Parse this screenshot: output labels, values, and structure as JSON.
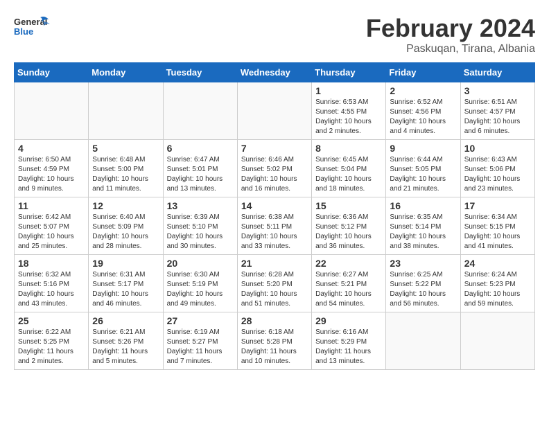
{
  "header": {
    "logo_general": "General",
    "logo_blue": "Blue",
    "month": "February 2024",
    "location": "Paskuqan, Tirana, Albania"
  },
  "weekdays": [
    "Sunday",
    "Monday",
    "Tuesday",
    "Wednesday",
    "Thursday",
    "Friday",
    "Saturday"
  ],
  "weeks": [
    [
      {
        "day": "",
        "info": ""
      },
      {
        "day": "",
        "info": ""
      },
      {
        "day": "",
        "info": ""
      },
      {
        "day": "",
        "info": ""
      },
      {
        "day": "1",
        "info": "Sunrise: 6:53 AM\nSunset: 4:55 PM\nDaylight: 10 hours\nand 2 minutes."
      },
      {
        "day": "2",
        "info": "Sunrise: 6:52 AM\nSunset: 4:56 PM\nDaylight: 10 hours\nand 4 minutes."
      },
      {
        "day": "3",
        "info": "Sunrise: 6:51 AM\nSunset: 4:57 PM\nDaylight: 10 hours\nand 6 minutes."
      }
    ],
    [
      {
        "day": "4",
        "info": "Sunrise: 6:50 AM\nSunset: 4:59 PM\nDaylight: 10 hours\nand 9 minutes."
      },
      {
        "day": "5",
        "info": "Sunrise: 6:48 AM\nSunset: 5:00 PM\nDaylight: 10 hours\nand 11 minutes."
      },
      {
        "day": "6",
        "info": "Sunrise: 6:47 AM\nSunset: 5:01 PM\nDaylight: 10 hours\nand 13 minutes."
      },
      {
        "day": "7",
        "info": "Sunrise: 6:46 AM\nSunset: 5:02 PM\nDaylight: 10 hours\nand 16 minutes."
      },
      {
        "day": "8",
        "info": "Sunrise: 6:45 AM\nSunset: 5:04 PM\nDaylight: 10 hours\nand 18 minutes."
      },
      {
        "day": "9",
        "info": "Sunrise: 6:44 AM\nSunset: 5:05 PM\nDaylight: 10 hours\nand 21 minutes."
      },
      {
        "day": "10",
        "info": "Sunrise: 6:43 AM\nSunset: 5:06 PM\nDaylight: 10 hours\nand 23 minutes."
      }
    ],
    [
      {
        "day": "11",
        "info": "Sunrise: 6:42 AM\nSunset: 5:07 PM\nDaylight: 10 hours\nand 25 minutes."
      },
      {
        "day": "12",
        "info": "Sunrise: 6:40 AM\nSunset: 5:09 PM\nDaylight: 10 hours\nand 28 minutes."
      },
      {
        "day": "13",
        "info": "Sunrise: 6:39 AM\nSunset: 5:10 PM\nDaylight: 10 hours\nand 30 minutes."
      },
      {
        "day": "14",
        "info": "Sunrise: 6:38 AM\nSunset: 5:11 PM\nDaylight: 10 hours\nand 33 minutes."
      },
      {
        "day": "15",
        "info": "Sunrise: 6:36 AM\nSunset: 5:12 PM\nDaylight: 10 hours\nand 36 minutes."
      },
      {
        "day": "16",
        "info": "Sunrise: 6:35 AM\nSunset: 5:14 PM\nDaylight: 10 hours\nand 38 minutes."
      },
      {
        "day": "17",
        "info": "Sunrise: 6:34 AM\nSunset: 5:15 PM\nDaylight: 10 hours\nand 41 minutes."
      }
    ],
    [
      {
        "day": "18",
        "info": "Sunrise: 6:32 AM\nSunset: 5:16 PM\nDaylight: 10 hours\nand 43 minutes."
      },
      {
        "day": "19",
        "info": "Sunrise: 6:31 AM\nSunset: 5:17 PM\nDaylight: 10 hours\nand 46 minutes."
      },
      {
        "day": "20",
        "info": "Sunrise: 6:30 AM\nSunset: 5:19 PM\nDaylight: 10 hours\nand 49 minutes."
      },
      {
        "day": "21",
        "info": "Sunrise: 6:28 AM\nSunset: 5:20 PM\nDaylight: 10 hours\nand 51 minutes."
      },
      {
        "day": "22",
        "info": "Sunrise: 6:27 AM\nSunset: 5:21 PM\nDaylight: 10 hours\nand 54 minutes."
      },
      {
        "day": "23",
        "info": "Sunrise: 6:25 AM\nSunset: 5:22 PM\nDaylight: 10 hours\nand 56 minutes."
      },
      {
        "day": "24",
        "info": "Sunrise: 6:24 AM\nSunset: 5:23 PM\nDaylight: 10 hours\nand 59 minutes."
      }
    ],
    [
      {
        "day": "25",
        "info": "Sunrise: 6:22 AM\nSunset: 5:25 PM\nDaylight: 11 hours\nand 2 minutes."
      },
      {
        "day": "26",
        "info": "Sunrise: 6:21 AM\nSunset: 5:26 PM\nDaylight: 11 hours\nand 5 minutes."
      },
      {
        "day": "27",
        "info": "Sunrise: 6:19 AM\nSunset: 5:27 PM\nDaylight: 11 hours\nand 7 minutes."
      },
      {
        "day": "28",
        "info": "Sunrise: 6:18 AM\nSunset: 5:28 PM\nDaylight: 11 hours\nand 10 minutes."
      },
      {
        "day": "29",
        "info": "Sunrise: 6:16 AM\nSunset: 5:29 PM\nDaylight: 11 hours\nand 13 minutes."
      },
      {
        "day": "",
        "info": ""
      },
      {
        "day": "",
        "info": ""
      }
    ]
  ]
}
